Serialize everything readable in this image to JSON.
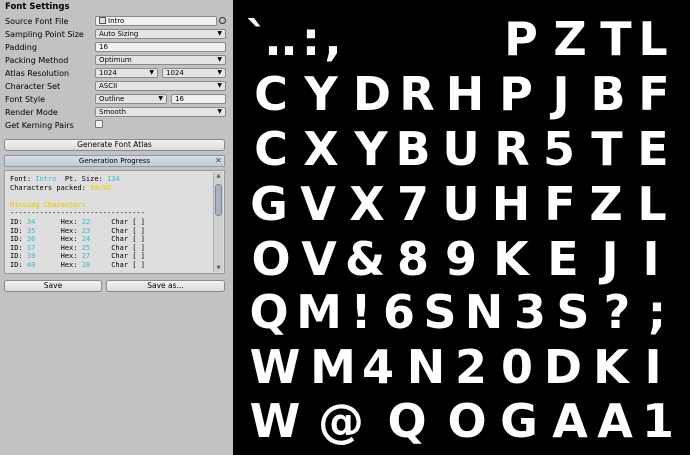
{
  "panel": {
    "title": "Font Settings",
    "fields": {
      "source_font_label": "Source Font File",
      "source_font_value": "Intro",
      "sampling_label": "Sampling Point Size",
      "sampling_value": "Auto Sizing",
      "padding_label": "Padding",
      "padding_value": "16",
      "packing_label": "Packing Method",
      "packing_value": "Optimum",
      "atlas_res_label": "Atlas Resolution",
      "atlas_res_w": "1024",
      "atlas_res_h": "1024",
      "charset_label": "Character Set",
      "charset_value": "ASCII",
      "font_style_label": "Font Style",
      "font_style_value": "Outline",
      "font_style_size": "16",
      "render_mode_label": "Render Mode",
      "render_mode_value": "Smooth",
      "kerning_label": "Get Kerning Pairs"
    },
    "generate_button": "Generate Font Atlas",
    "progress_section": "Generation Progress",
    "console": {
      "font_label": "Font:",
      "font_value": "Intro",
      "pt_label": "Pt. Size:",
      "pt_value": "134",
      "packed_label": "Characters packed:",
      "packed_value": "93/95",
      "missing_title": "Missing Characters",
      "divider": "--------------------------------",
      "rows": [
        {
          "id": "34",
          "hex": "22",
          "char": "[ ]"
        },
        {
          "id": "35",
          "hex": "23",
          "char": "[ ]"
        },
        {
          "id": "36",
          "hex": "24",
          "char": "[ ]"
        },
        {
          "id": "37",
          "hex": "25",
          "char": "[ ]"
        },
        {
          "id": "39",
          "hex": "27",
          "char": "[ ]"
        },
        {
          "id": "40",
          "hex": "28",
          "char": "[ ]"
        }
      ],
      "id_label": "ID:",
      "hex_label": "Hex:",
      "char_label": "Char"
    },
    "save_button": "Save",
    "save_as_button": "Save as..."
  },
  "atlas": {
    "rows": [
      [
        "`",
        ".",
        ".",
        ":",
        ",",
        "P",
        "Z",
        "T",
        "L"
      ],
      [
        "C",
        "Y",
        "D",
        "R",
        "H",
        "P",
        "J",
        "B",
        "F"
      ],
      [
        "C",
        "X",
        "Y",
        "B",
        "U",
        "R",
        "5",
        "T",
        "E"
      ],
      [
        "G",
        "V",
        "X",
        "7",
        "U",
        "H",
        "F",
        "Z",
        "L"
      ],
      [
        "O",
        "V",
        "&",
        "8",
        "9",
        "K",
        "E",
        "J",
        "I"
      ],
      [
        "Q",
        "M",
        "!",
        "6",
        "S",
        "N",
        "3",
        "S",
        "?",
        ";"
      ],
      [
        "W",
        "M",
        "4",
        "N",
        "2",
        "0",
        "D",
        "K",
        "I"
      ],
      [
        "W",
        "@",
        "Q",
        "O",
        "G",
        "A",
        "A",
        "1"
      ]
    ]
  },
  "icons": {
    "object_field": "object-icon",
    "picker": "circle-picker-icon",
    "dropdown": "triangle-down-icon",
    "close": "close-icon"
  }
}
